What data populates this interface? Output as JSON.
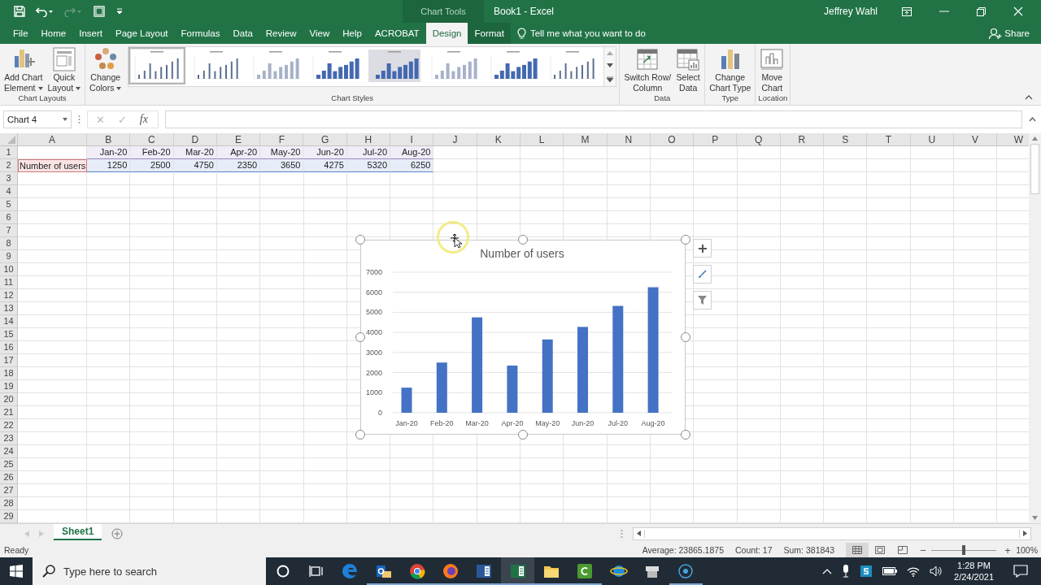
{
  "title_bar": {
    "context": "Chart Tools",
    "title": "Book1  -  Excel",
    "user": "Jeffrey Wahl"
  },
  "menu_tabs": [
    {
      "label": "File",
      "selected": false
    },
    {
      "label": "Home",
      "selected": false
    },
    {
      "label": "Insert",
      "selected": false
    },
    {
      "label": "Page Layout",
      "selected": false
    },
    {
      "label": "Formulas",
      "selected": false
    },
    {
      "label": "Data",
      "selected": false
    },
    {
      "label": "Review",
      "selected": false
    },
    {
      "label": "View",
      "selected": false
    },
    {
      "label": "Help",
      "selected": false
    },
    {
      "label": "ACROBAT",
      "selected": false
    },
    {
      "label": "Design",
      "selected": true
    },
    {
      "label": "Format",
      "selected": false
    }
  ],
  "tell_me": "Tell me what you want to do",
  "share": "Share",
  "ribbon": [
    {
      "label": "Chart Layouts",
      "buttons": [
        {
          "kind": "add-element",
          "lines": [
            "Add Chart",
            "Element"
          ],
          "dropdown": true
        },
        {
          "kind": "quick-layout",
          "lines": [
            "Quick",
            "Layout"
          ],
          "dropdown": true
        }
      ]
    },
    {
      "label": "Chart Styles",
      "buttons": [
        {
          "kind": "colors",
          "lines": [
            "Change",
            "Colors"
          ],
          "dropdown": true
        }
      ],
      "gallery": [
        {
          "kind": "thin",
          "selected": true
        },
        {
          "kind": "thin",
          "selected": false
        },
        {
          "kind": "pale",
          "selected": false
        },
        {
          "kind": "filled",
          "selected": false
        },
        {
          "kind": "shaded",
          "selected": false
        },
        {
          "kind": "pale",
          "selected": false
        },
        {
          "kind": "filled",
          "selected": false
        },
        {
          "kind": "thin",
          "selected": false
        }
      ]
    },
    {
      "label": "Data",
      "buttons": [
        {
          "kind": "switch",
          "lines": [
            "Switch Row/",
            "Column"
          ],
          "dropdown": false
        },
        {
          "kind": "select-data",
          "lines": [
            "Select",
            "Data"
          ],
          "dropdown": false
        }
      ]
    },
    {
      "label": "Type",
      "buttons": [
        {
          "kind": "chart-type",
          "lines": [
            "Change",
            "Chart Type"
          ],
          "dropdown": false
        }
      ]
    },
    {
      "label": "Location",
      "buttons": [
        {
          "kind": "move",
          "lines": [
            "Move",
            "Chart"
          ],
          "dropdown": false
        }
      ]
    }
  ],
  "formula_bar": {
    "name_box": "Chart 4",
    "cancel": "✕",
    "enter": "✓",
    "fx": "fx"
  },
  "sheet": {
    "columns": [
      "A",
      "B",
      "C",
      "D",
      "E",
      "F",
      "G",
      "H",
      "I",
      "J",
      "K",
      "L",
      "M",
      "N",
      "O",
      "P",
      "Q",
      "R",
      "S",
      "T",
      "U",
      "V",
      "W"
    ],
    "row_numbers": [
      "1",
      "2",
      "3",
      "4",
      "5",
      "6",
      "7",
      "8",
      "9",
      "10",
      "11",
      "12",
      "13",
      "14",
      "15",
      "16",
      "17",
      "18",
      "19",
      "20",
      "21",
      "22",
      "23",
      "24",
      "25",
      "26",
      "27",
      "28",
      "29"
    ],
    "rows": [
      {
        "cells": [
          null,
          "Jan-20",
          "Feb-20",
          "Mar-20",
          "Apr-20",
          "May-20",
          "Jun-20",
          "Jul-20",
          "Aug-20"
        ]
      },
      {
        "cells": [
          "Number of users",
          "1250",
          "2500",
          "4750",
          "2350",
          "3650",
          "4275",
          "5320",
          "6250"
        ]
      }
    ]
  },
  "chart": {
    "chart_data": {
      "type": "bar",
      "title": "Number of users",
      "categories": [
        "Jan-20",
        "Feb-20",
        "Mar-20",
        "Apr-20",
        "May-20",
        "Jun-20",
        "Jul-20",
        "Aug-20"
      ],
      "series": [
        {
          "color": "#4472c4",
          "values": [
            1250,
            2500,
            4750,
            2350,
            3650,
            4275,
            5320,
            6250
          ]
        }
      ],
      "ylim": [
        0,
        7000
      ],
      "grid": true,
      "yticks": [
        0,
        1000,
        2000,
        3000,
        4000,
        5000,
        6000,
        7000
      ]
    }
  },
  "sheet_tabs": [
    {
      "label": "Sheet1",
      "selected": true
    }
  ],
  "status_bar": {
    "mode": "Ready",
    "average": "Average: 23865.1875",
    "count": "Count: 17",
    "sum": "Sum: 381843",
    "zoom_minus": "−",
    "zoom_plus": "+",
    "zoom": {
      "level": 0.5,
      "reading": "100%"
    }
  },
  "taskbar": {
    "search_placeholder": "Type here to search",
    "apps": [
      {
        "kind": "edge",
        "running": false,
        "selected": false
      },
      {
        "kind": "outlook",
        "running": true,
        "selected": false
      },
      {
        "kind": "chrome",
        "running": true,
        "selected": false
      },
      {
        "kind": "firefox",
        "running": true,
        "selected": false
      },
      {
        "kind": "word",
        "running": true,
        "selected": false
      },
      {
        "kind": "excel",
        "running": true,
        "selected": true
      },
      {
        "kind": "explorer",
        "running": true,
        "selected": false
      },
      {
        "kind": "camtasia",
        "running": true,
        "selected": false
      },
      {
        "kind": "ie",
        "running": false,
        "selected": false
      },
      {
        "kind": "device",
        "running": false,
        "selected": false
      },
      {
        "kind": "disc",
        "running": true,
        "selected": false
      }
    ],
    "time": "1:28 PM",
    "date": "2/24/2021"
  }
}
